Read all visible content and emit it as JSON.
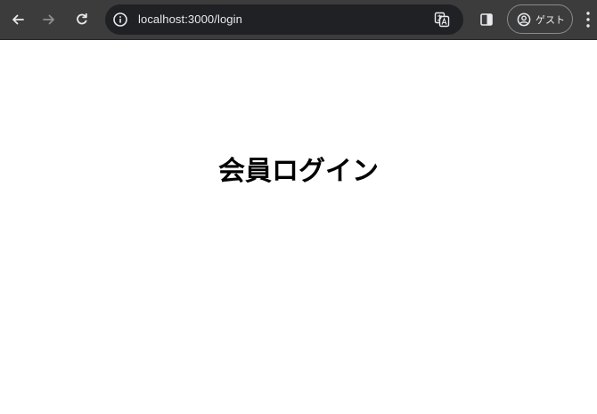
{
  "browser": {
    "url": "localhost:3000/login",
    "profile_label": "ゲスト"
  },
  "toolbar_icons": [
    "back-arrow-icon",
    "forward-arrow-icon",
    "reload-icon",
    "site-info-icon",
    "translate-icon",
    "side-panel-icon",
    "profile-icon",
    "kebab-menu-icon"
  ],
  "colors": {
    "toolbar_bg": "#3c3c3c",
    "omnibox_bg": "#202124",
    "toolbar_text": "#e8eaed",
    "page_bg": "#ffffff"
  },
  "page": {
    "title": "会員ログイン"
  }
}
